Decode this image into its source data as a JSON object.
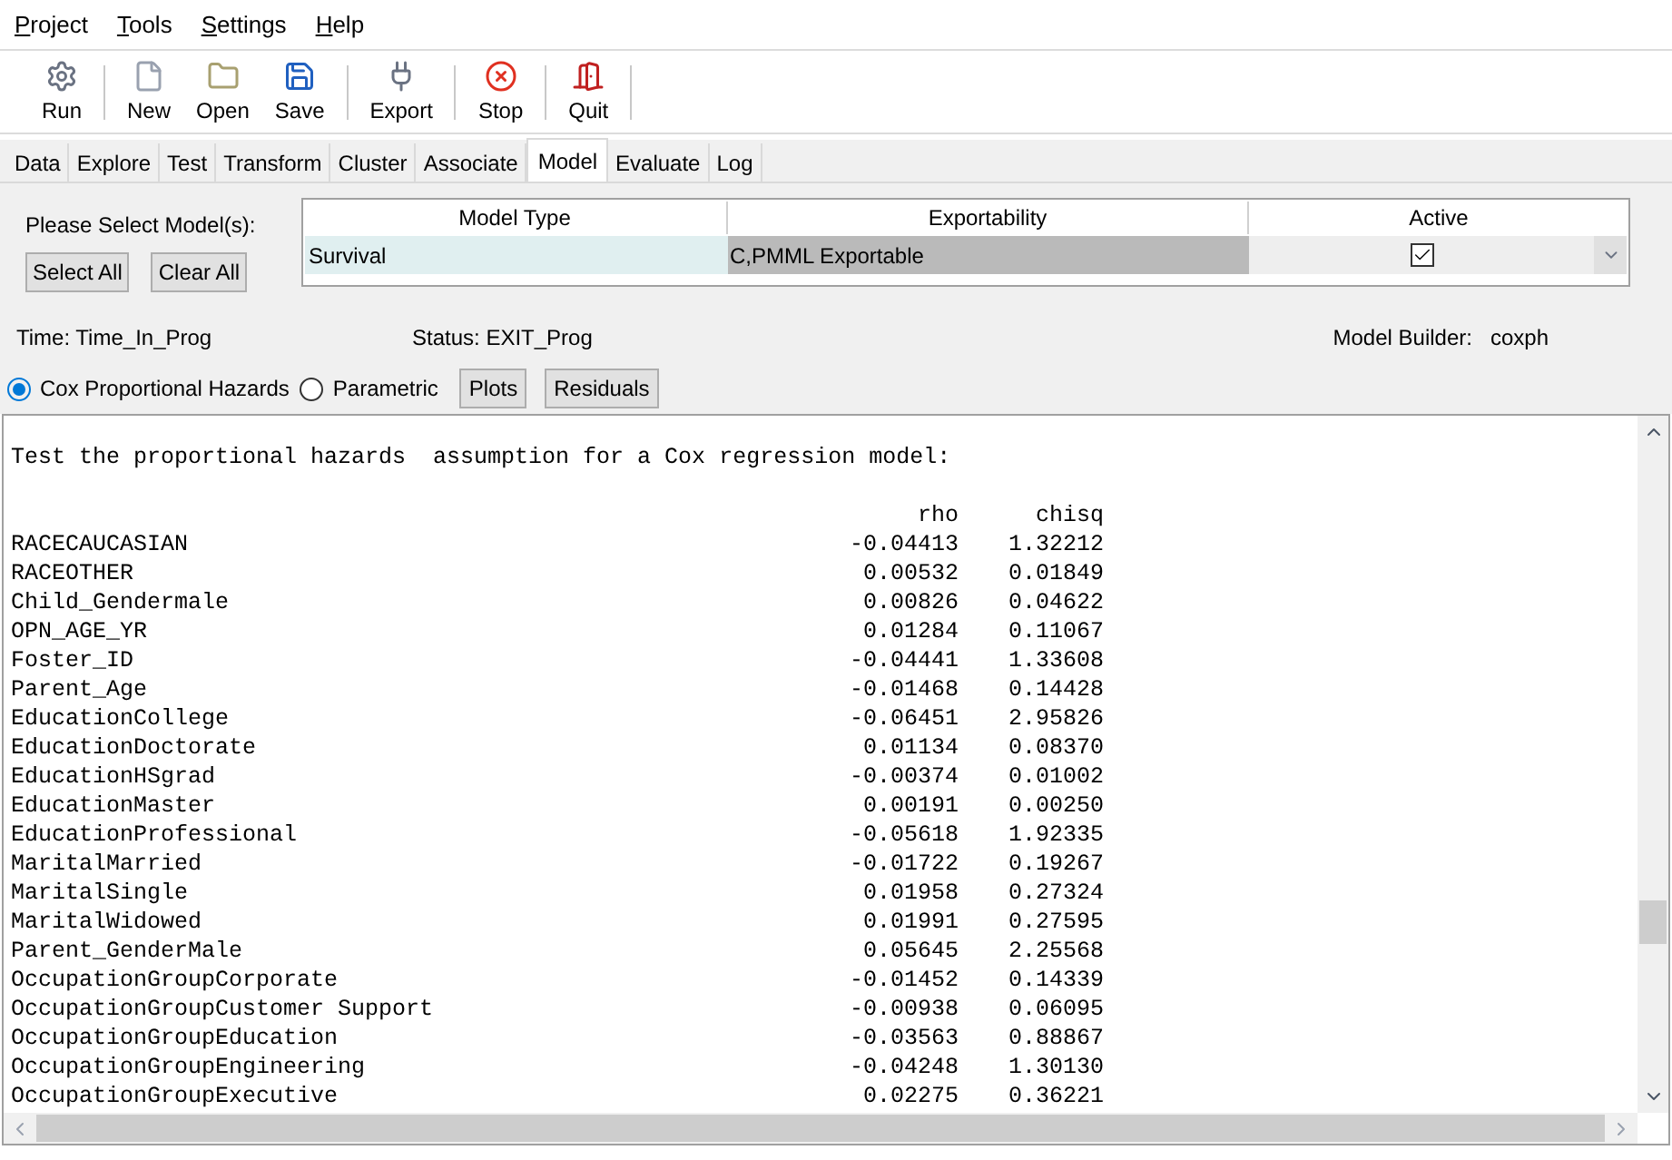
{
  "menu": [
    "Project",
    "Tools",
    "Settings",
    "Help"
  ],
  "toolbar": [
    {
      "kind": "run",
      "label": "Run"
    },
    {
      "kind": "new",
      "label": "New"
    },
    {
      "kind": "open",
      "label": "Open"
    },
    {
      "kind": "save",
      "label": "Save"
    },
    {
      "kind": "export",
      "label": "Export"
    },
    {
      "kind": "stop",
      "label": "Stop"
    },
    {
      "kind": "quit",
      "label": "Quit"
    }
  ],
  "tabs": [
    {
      "label": "Data",
      "selected": false
    },
    {
      "label": "Explore",
      "selected": false
    },
    {
      "label": "Test",
      "selected": false
    },
    {
      "label": "Transform",
      "selected": false
    },
    {
      "label": "Cluster",
      "selected": false
    },
    {
      "label": "Associate",
      "selected": false
    },
    {
      "label": "Model",
      "selected": true
    },
    {
      "label": "Evaluate",
      "selected": false
    },
    {
      "label": "Log",
      "selected": false
    }
  ],
  "model_panel": {
    "prompt": "Please Select Model(s):",
    "buttons": [
      "Select All",
      "Clear All"
    ],
    "table": {
      "columns": [
        "Model Type",
        "Exportability",
        "Active"
      ],
      "rows": [
        {
          "model_type": "Survival",
          "exportability": "C,PMML Exportable",
          "active": true
        }
      ]
    },
    "time": "Time: Time_In_Prog",
    "status": "Status: EXIT_Prog",
    "builder_label": "Model Builder:",
    "builder_value": "coxph",
    "options": [
      {
        "label": "Cox Proportional Hazards",
        "selected": true
      },
      {
        "label": "Parametric",
        "selected": false
      }
    ],
    "actions": [
      "Plots",
      "Residuals"
    ]
  },
  "output": {
    "title": "Test the proportional hazards  assumption for a Cox regression model:",
    "columns": [
      "rho",
      "chisq"
    ],
    "rows": [
      {
        "name": "RACECAUCASIAN",
        "rho": "-0.04413",
        "chisq": "1.32212"
      },
      {
        "name": "RACEOTHER",
        "rho": "0.00532",
        "chisq": "0.01849"
      },
      {
        "name": "Child_Gendermale",
        "rho": "0.00826",
        "chisq": "0.04622"
      },
      {
        "name": "OPN_AGE_YR",
        "rho": "0.01284",
        "chisq": "0.11067"
      },
      {
        "name": "Foster_ID",
        "rho": "-0.04441",
        "chisq": "1.33608"
      },
      {
        "name": "Parent_Age",
        "rho": "-0.01468",
        "chisq": "0.14428"
      },
      {
        "name": "EducationCollege",
        "rho": "-0.06451",
        "chisq": "2.95826"
      },
      {
        "name": "EducationDoctorate",
        "rho": "0.01134",
        "chisq": "0.08370"
      },
      {
        "name": "EducationHSgrad",
        "rho": "-0.00374",
        "chisq": "0.01002"
      },
      {
        "name": "EducationMaster",
        "rho": "0.00191",
        "chisq": "0.00250"
      },
      {
        "name": "EducationProfessional",
        "rho": "-0.05618",
        "chisq": "1.92335"
      },
      {
        "name": "MaritalMarried",
        "rho": "-0.01722",
        "chisq": "0.19267"
      },
      {
        "name": "MaritalSingle",
        "rho": "0.01958",
        "chisq": "0.27324"
      },
      {
        "name": "MaritalWidowed",
        "rho": "0.01991",
        "chisq": "0.27595"
      },
      {
        "name": "Parent_GenderMale",
        "rho": "0.05645",
        "chisq": "2.25568"
      },
      {
        "name": "OccupationGroupCorporate",
        "rho": "-0.01452",
        "chisq": "0.14339"
      },
      {
        "name": "OccupationGroupCustomer Support",
        "rho": "-0.00938",
        "chisq": "0.06095"
      },
      {
        "name": "OccupationGroupEducation",
        "rho": "-0.03563",
        "chisq": "0.88867"
      },
      {
        "name": "OccupationGroupEngineering",
        "rho": "-0.04248",
        "chisq": "1.30130"
      },
      {
        "name": "OccupationGroupExecutive",
        "rho": "0.02275",
        "chisq": "0.36221"
      }
    ]
  }
}
